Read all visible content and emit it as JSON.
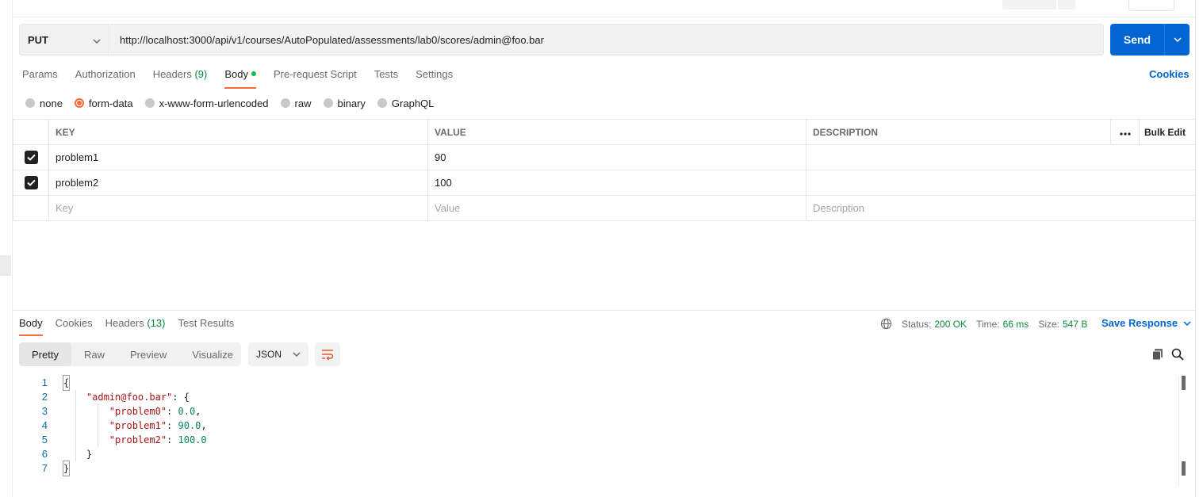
{
  "request": {
    "method": "PUT",
    "url": "http://localhost:3000/api/v1/courses/AutoPopulated/assessments/lab0/scores/admin@foo.bar",
    "send_label": "Send"
  },
  "request_tabs": {
    "params": "Params",
    "authorization": "Authorization",
    "headers": "Headers",
    "headers_count": "(9)",
    "body": "Body",
    "prerequest": "Pre-request Script",
    "tests": "Tests",
    "settings": "Settings",
    "cookies": "Cookies"
  },
  "body_types": {
    "none": "none",
    "form_data": "form-data",
    "urlencoded": "x-www-form-urlencoded",
    "raw": "raw",
    "binary": "binary",
    "graphql": "GraphQL",
    "selected": "form-data"
  },
  "form_table": {
    "headers": {
      "key": "KEY",
      "value": "VALUE",
      "description": "DESCRIPTION",
      "bulk_edit": "Bulk Edit"
    },
    "rows": [
      {
        "key": "problem1",
        "value": "90",
        "checked": true
      },
      {
        "key": "problem2",
        "value": "100",
        "checked": true
      }
    ],
    "placeholders": {
      "key": "Key",
      "value": "Value",
      "description": "Description"
    }
  },
  "response_tabs": {
    "body": "Body",
    "cookies": "Cookies",
    "headers": "Headers",
    "headers_count": "(13)",
    "test_results": "Test Results"
  },
  "response_status": {
    "status_label": "Status:",
    "status": "200 OK",
    "time_label": "Time:",
    "time": "66 ms",
    "size_label": "Size:",
    "size": "547 B",
    "save_response": "Save Response"
  },
  "response_view": {
    "modes": [
      "Pretty",
      "Raw",
      "Preview",
      "Visualize"
    ],
    "format": "JSON"
  },
  "response_code": {
    "line_numbers": [
      "1",
      "2",
      "3",
      "4",
      "5",
      "6",
      "7"
    ],
    "user_key": "\"admin@foo.bar\"",
    "p0_key": "\"problem0\"",
    "p0_val": "0.0",
    "p1_key": "\"problem1\"",
    "p1_val": "90.0",
    "p2_key": "\"problem2\"",
    "p2_val": "100.0"
  },
  "colors": {
    "accent": "#ff6c37",
    "primary": "#0265d2",
    "success": "#0b8a3e"
  },
  "icons": [
    "chevron-down-icon",
    "globe-icon",
    "more-icon",
    "wrap-icon",
    "copy-icon",
    "search-icon",
    "check-icon"
  ]
}
